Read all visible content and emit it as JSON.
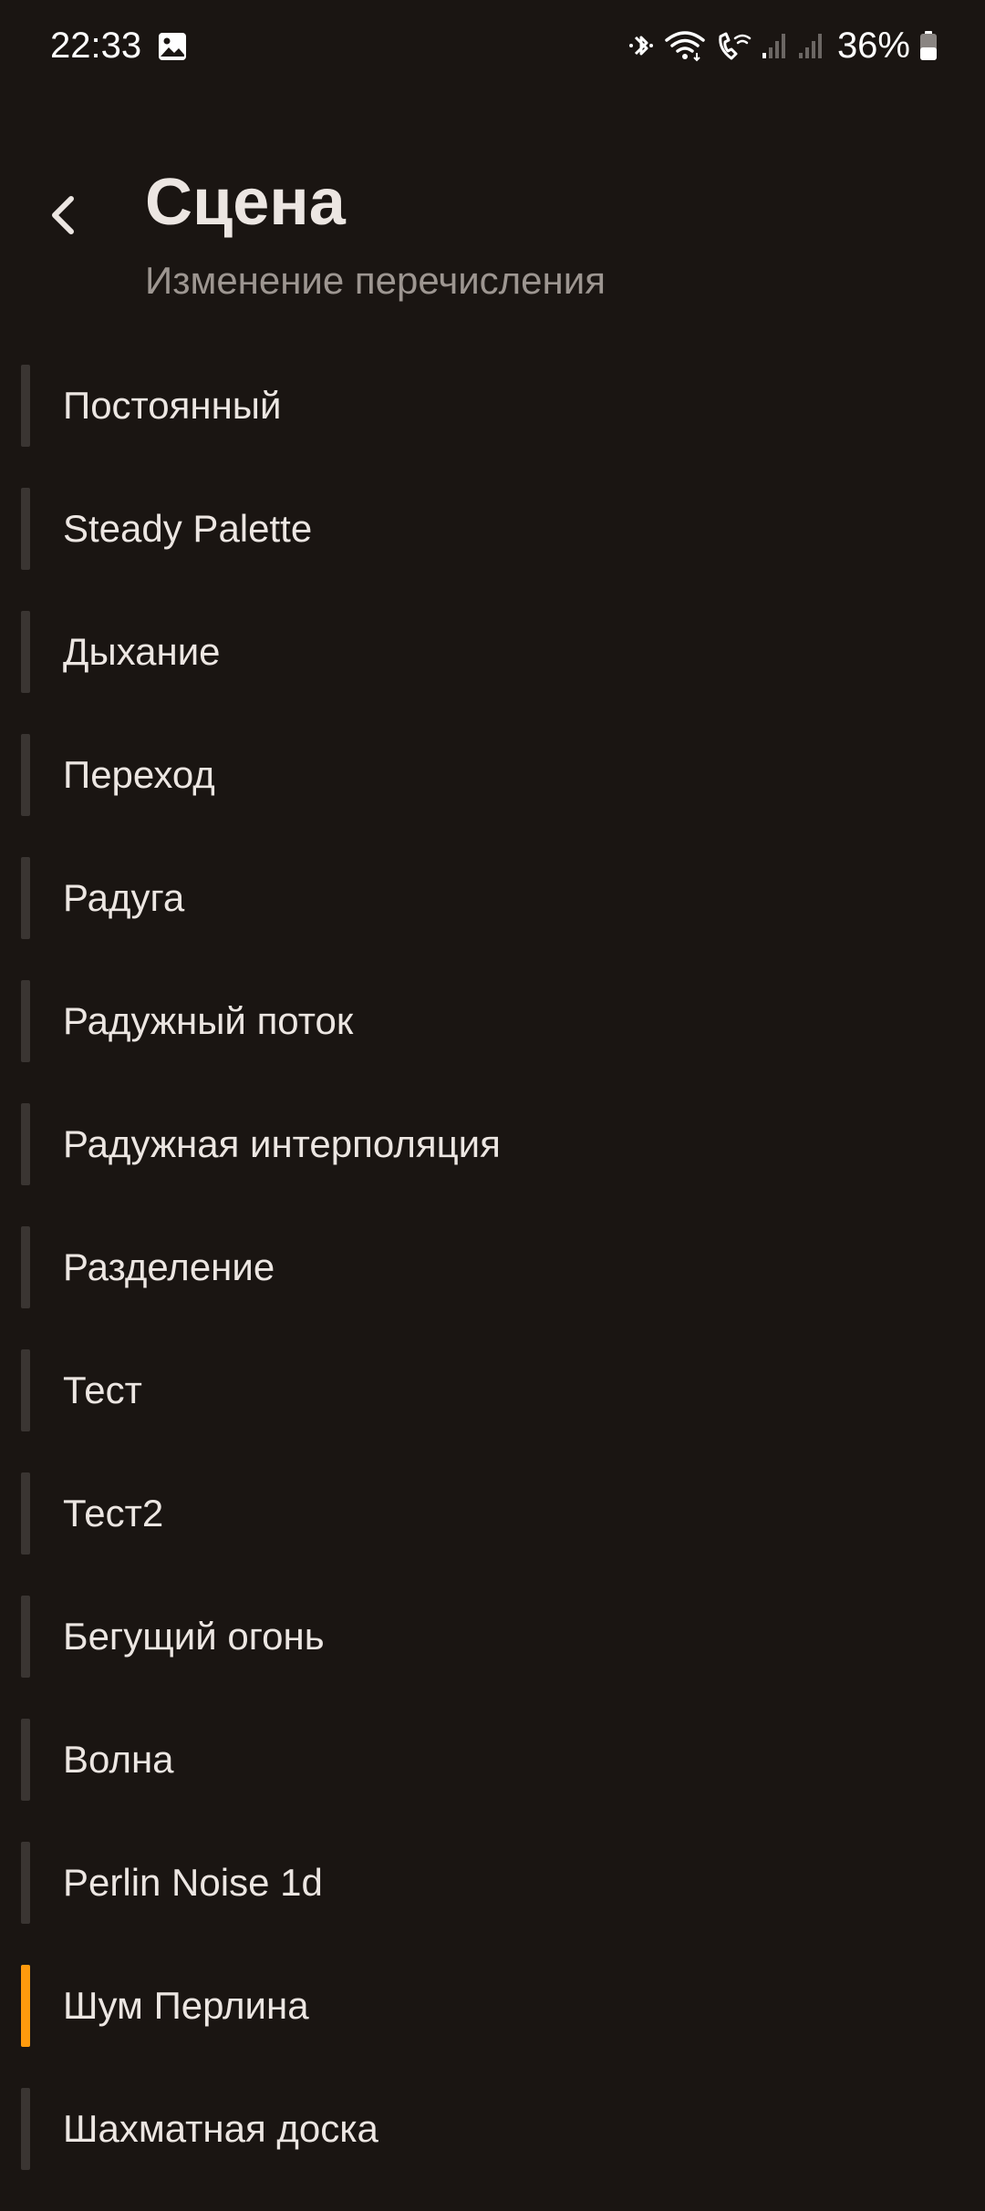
{
  "status_bar": {
    "time": "22:33",
    "battery": "36%",
    "icons": [
      "gallery-icon",
      "bluetooth-icon",
      "wifi-icon",
      "wifi-calling-icon",
      "signal-icon",
      "signal-icon",
      "battery-icon"
    ]
  },
  "header": {
    "title": "Сцена",
    "subtitle": "Изменение перечисления"
  },
  "colors": {
    "background": "#1a1512",
    "accent": "#ff9a0d",
    "indicator": "#3a3532",
    "text": "#ece6e2",
    "subtext": "#9d9691"
  },
  "scenes": [
    {
      "label": "Постоянный",
      "selected": false
    },
    {
      "label": "Steady Palette",
      "selected": false
    },
    {
      "label": "Дыхание",
      "selected": false
    },
    {
      "label": "Переход",
      "selected": false
    },
    {
      "label": "Радуга",
      "selected": false
    },
    {
      "label": "Радужный поток",
      "selected": false
    },
    {
      "label": "Радужная интерполяция",
      "selected": false
    },
    {
      "label": "Разделение",
      "selected": false
    },
    {
      "label": "Тест",
      "selected": false
    },
    {
      "label": "Тест2",
      "selected": false
    },
    {
      "label": "Бегущий огонь",
      "selected": false
    },
    {
      "label": "Волна",
      "selected": false
    },
    {
      "label": "Perlin Noise 1d",
      "selected": false
    },
    {
      "label": "Шум Перлина",
      "selected": true
    },
    {
      "label": "Шахматная доска",
      "selected": false
    }
  ]
}
